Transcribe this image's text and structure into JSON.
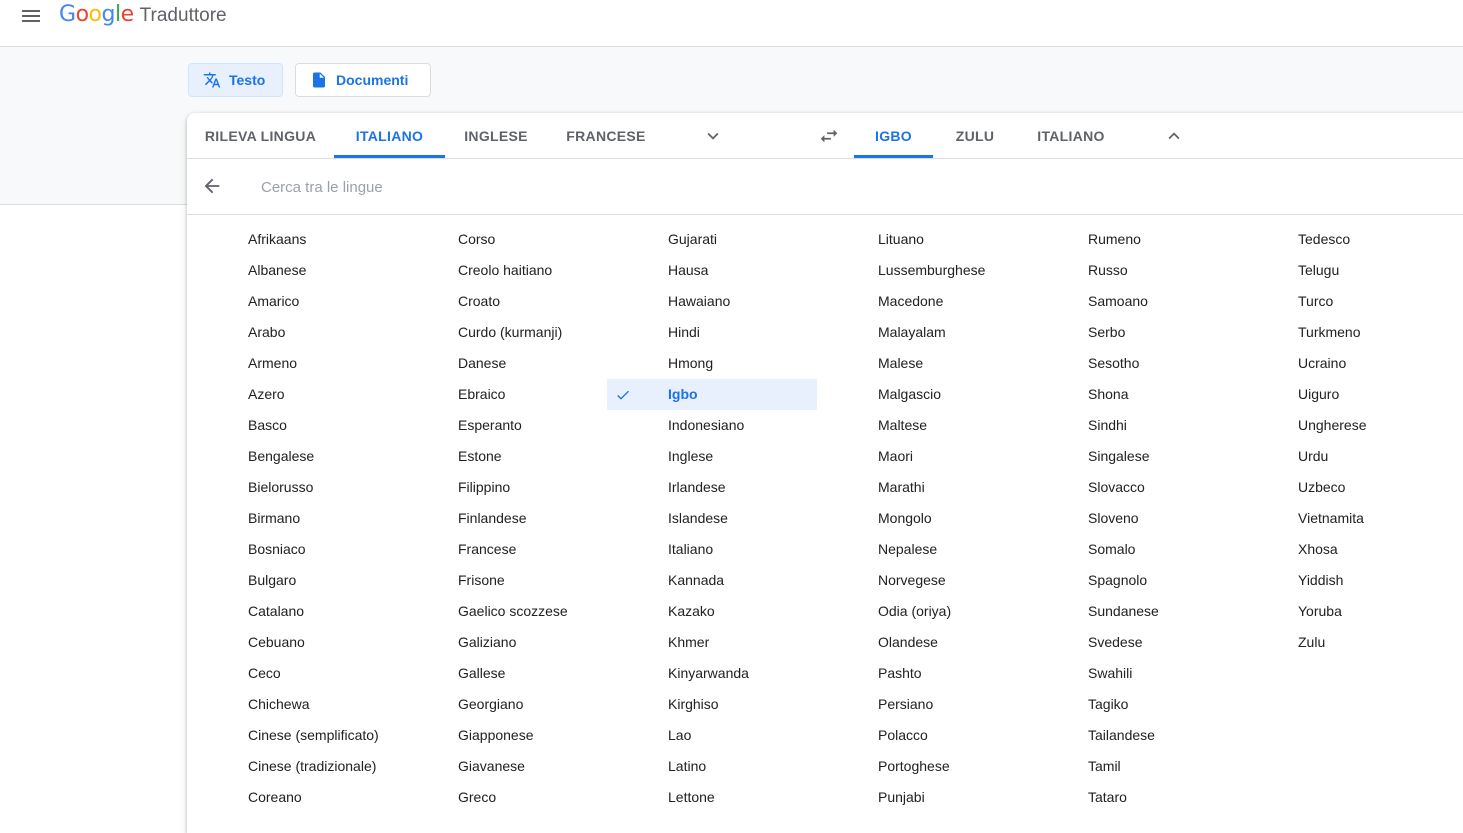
{
  "header": {
    "logo_word": "Google",
    "product": "Traduttore",
    "logo_colors": [
      "#4285f4",
      "#ea4335",
      "#fbbc05",
      "#4285f4",
      "#34a853",
      "#ea4335"
    ]
  },
  "modes": {
    "text_label": "Testo",
    "documents_label": "Documenti"
  },
  "source_tabs": [
    "RILEVA LINGUA",
    "ITALIANO",
    "INGLESE",
    "FRANCESE"
  ],
  "target_tabs": [
    "IGBO",
    "ZULU",
    "ITALIANO"
  ],
  "search": {
    "placeholder": "Cerca tra le lingue"
  },
  "selected_language": "Igbo",
  "accent_color": "#1a73e8",
  "languages": [
    [
      "Afrikaans",
      "Albanese",
      "Amarico",
      "Arabo",
      "Armeno",
      "Azero",
      "Basco",
      "Bengalese",
      "Bielorusso",
      "Birmano",
      "Bosniaco",
      "Bulgaro",
      "Catalano",
      "Cebuano",
      "Ceco",
      "Chichewa",
      "Cinese (semplificato)",
      "Cinese (tradizionale)",
      "Coreano"
    ],
    [
      "Corso",
      "Creolo haitiano",
      "Croato",
      "Curdo (kurmanji)",
      "Danese",
      "Ebraico",
      "Esperanto",
      "Estone",
      "Filippino",
      "Finlandese",
      "Francese",
      "Frisone",
      "Gaelico scozzese",
      "Galiziano",
      "Gallese",
      "Georgiano",
      "Giapponese",
      "Giavanese",
      "Greco"
    ],
    [
      "Gujarati",
      "Hausa",
      "Hawaiano",
      "Hindi",
      "Hmong",
      "Igbo",
      "Indonesiano",
      "Inglese",
      "Irlandese",
      "Islandese",
      "Italiano",
      "Kannada",
      "Kazako",
      "Khmer",
      "Kinyarwanda",
      "Kirghiso",
      "Lao",
      "Latino",
      "Lettone"
    ],
    [
      "Lituano",
      "Lussemburghese",
      "Macedone",
      "Malayalam",
      "Malese",
      "Malgascio",
      "Maltese",
      "Maori",
      "Marathi",
      "Mongolo",
      "Nepalese",
      "Norvegese",
      "Odia (oriya)",
      "Olandese",
      "Pashto",
      "Persiano",
      "Polacco",
      "Portoghese",
      "Punjabi"
    ],
    [
      "Rumeno",
      "Russo",
      "Samoano",
      "Serbo",
      "Sesotho",
      "Shona",
      "Sindhi",
      "Singalese",
      "Slovacco",
      "Sloveno",
      "Somalo",
      "Spagnolo",
      "Sundanese",
      "Svedese",
      "Swahili",
      "Tagiko",
      "Tailandese",
      "Tamil",
      "Tataro"
    ],
    [
      "Tedesco",
      "Telugu",
      "Turco",
      "Turkmeno",
      "Ucraino",
      "Uiguro",
      "Ungherese",
      "Urdu",
      "Uzbeco",
      "Vietnamita",
      "Xhosa",
      "Yiddish",
      "Yoruba",
      "Zulu"
    ]
  ]
}
